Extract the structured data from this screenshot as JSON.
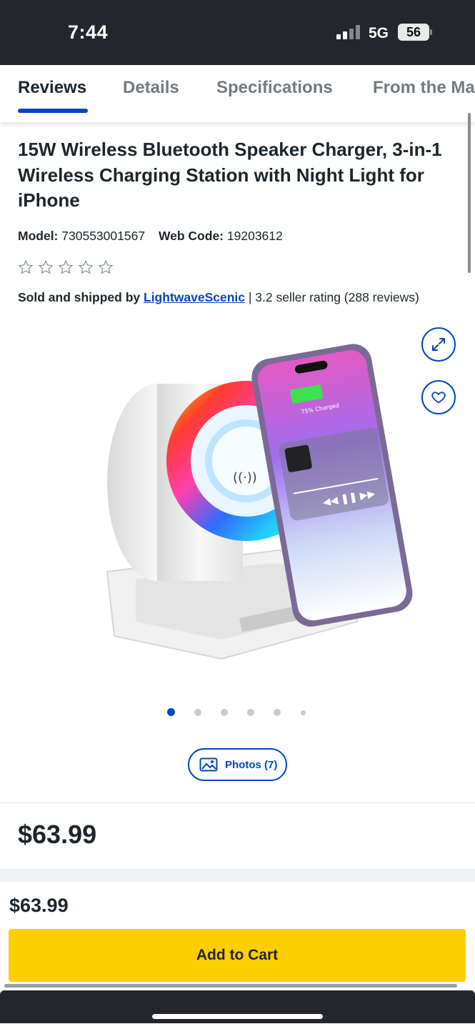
{
  "status_bar": {
    "time": "7:44",
    "network": "5G",
    "battery": "56"
  },
  "tabs": [
    {
      "label": "Reviews",
      "active": true
    },
    {
      "label": "Details",
      "active": false
    },
    {
      "label": "Specifications",
      "active": false
    },
    {
      "label": "From the Ma",
      "active": false
    }
  ],
  "product": {
    "title": "15W Wireless Bluetooth Speaker Charger, 3-in-1 Wireless Charging Station with Night Light for iPhone",
    "model_label": "Model:",
    "model_value": "730553001567",
    "webcode_label": "Web Code:",
    "webcode_value": "19203612",
    "rating_stars": 0,
    "sold_by_label": "Sold and shipped by",
    "seller_name": "LightwaveScenic",
    "seller_rating": "| 3.2 seller rating (288 reviews)"
  },
  "gallery": {
    "image_icons": {
      "expand": "expand-arrows-icon",
      "favorite": "heart-icon"
    },
    "phone_screen_text": "75% Charged",
    "dot_count": 6,
    "active_dot": 0,
    "photos_button": "Photos (7)",
    "photos_icon": "image-icon"
  },
  "price": {
    "main": "$63.99",
    "footer": "$63.99"
  },
  "cart": {
    "add_label": "Add to Cart"
  },
  "colors": {
    "brand_blue": "#0046be",
    "cart_yellow": "#ffce00",
    "status_bar": "#25262b"
  }
}
